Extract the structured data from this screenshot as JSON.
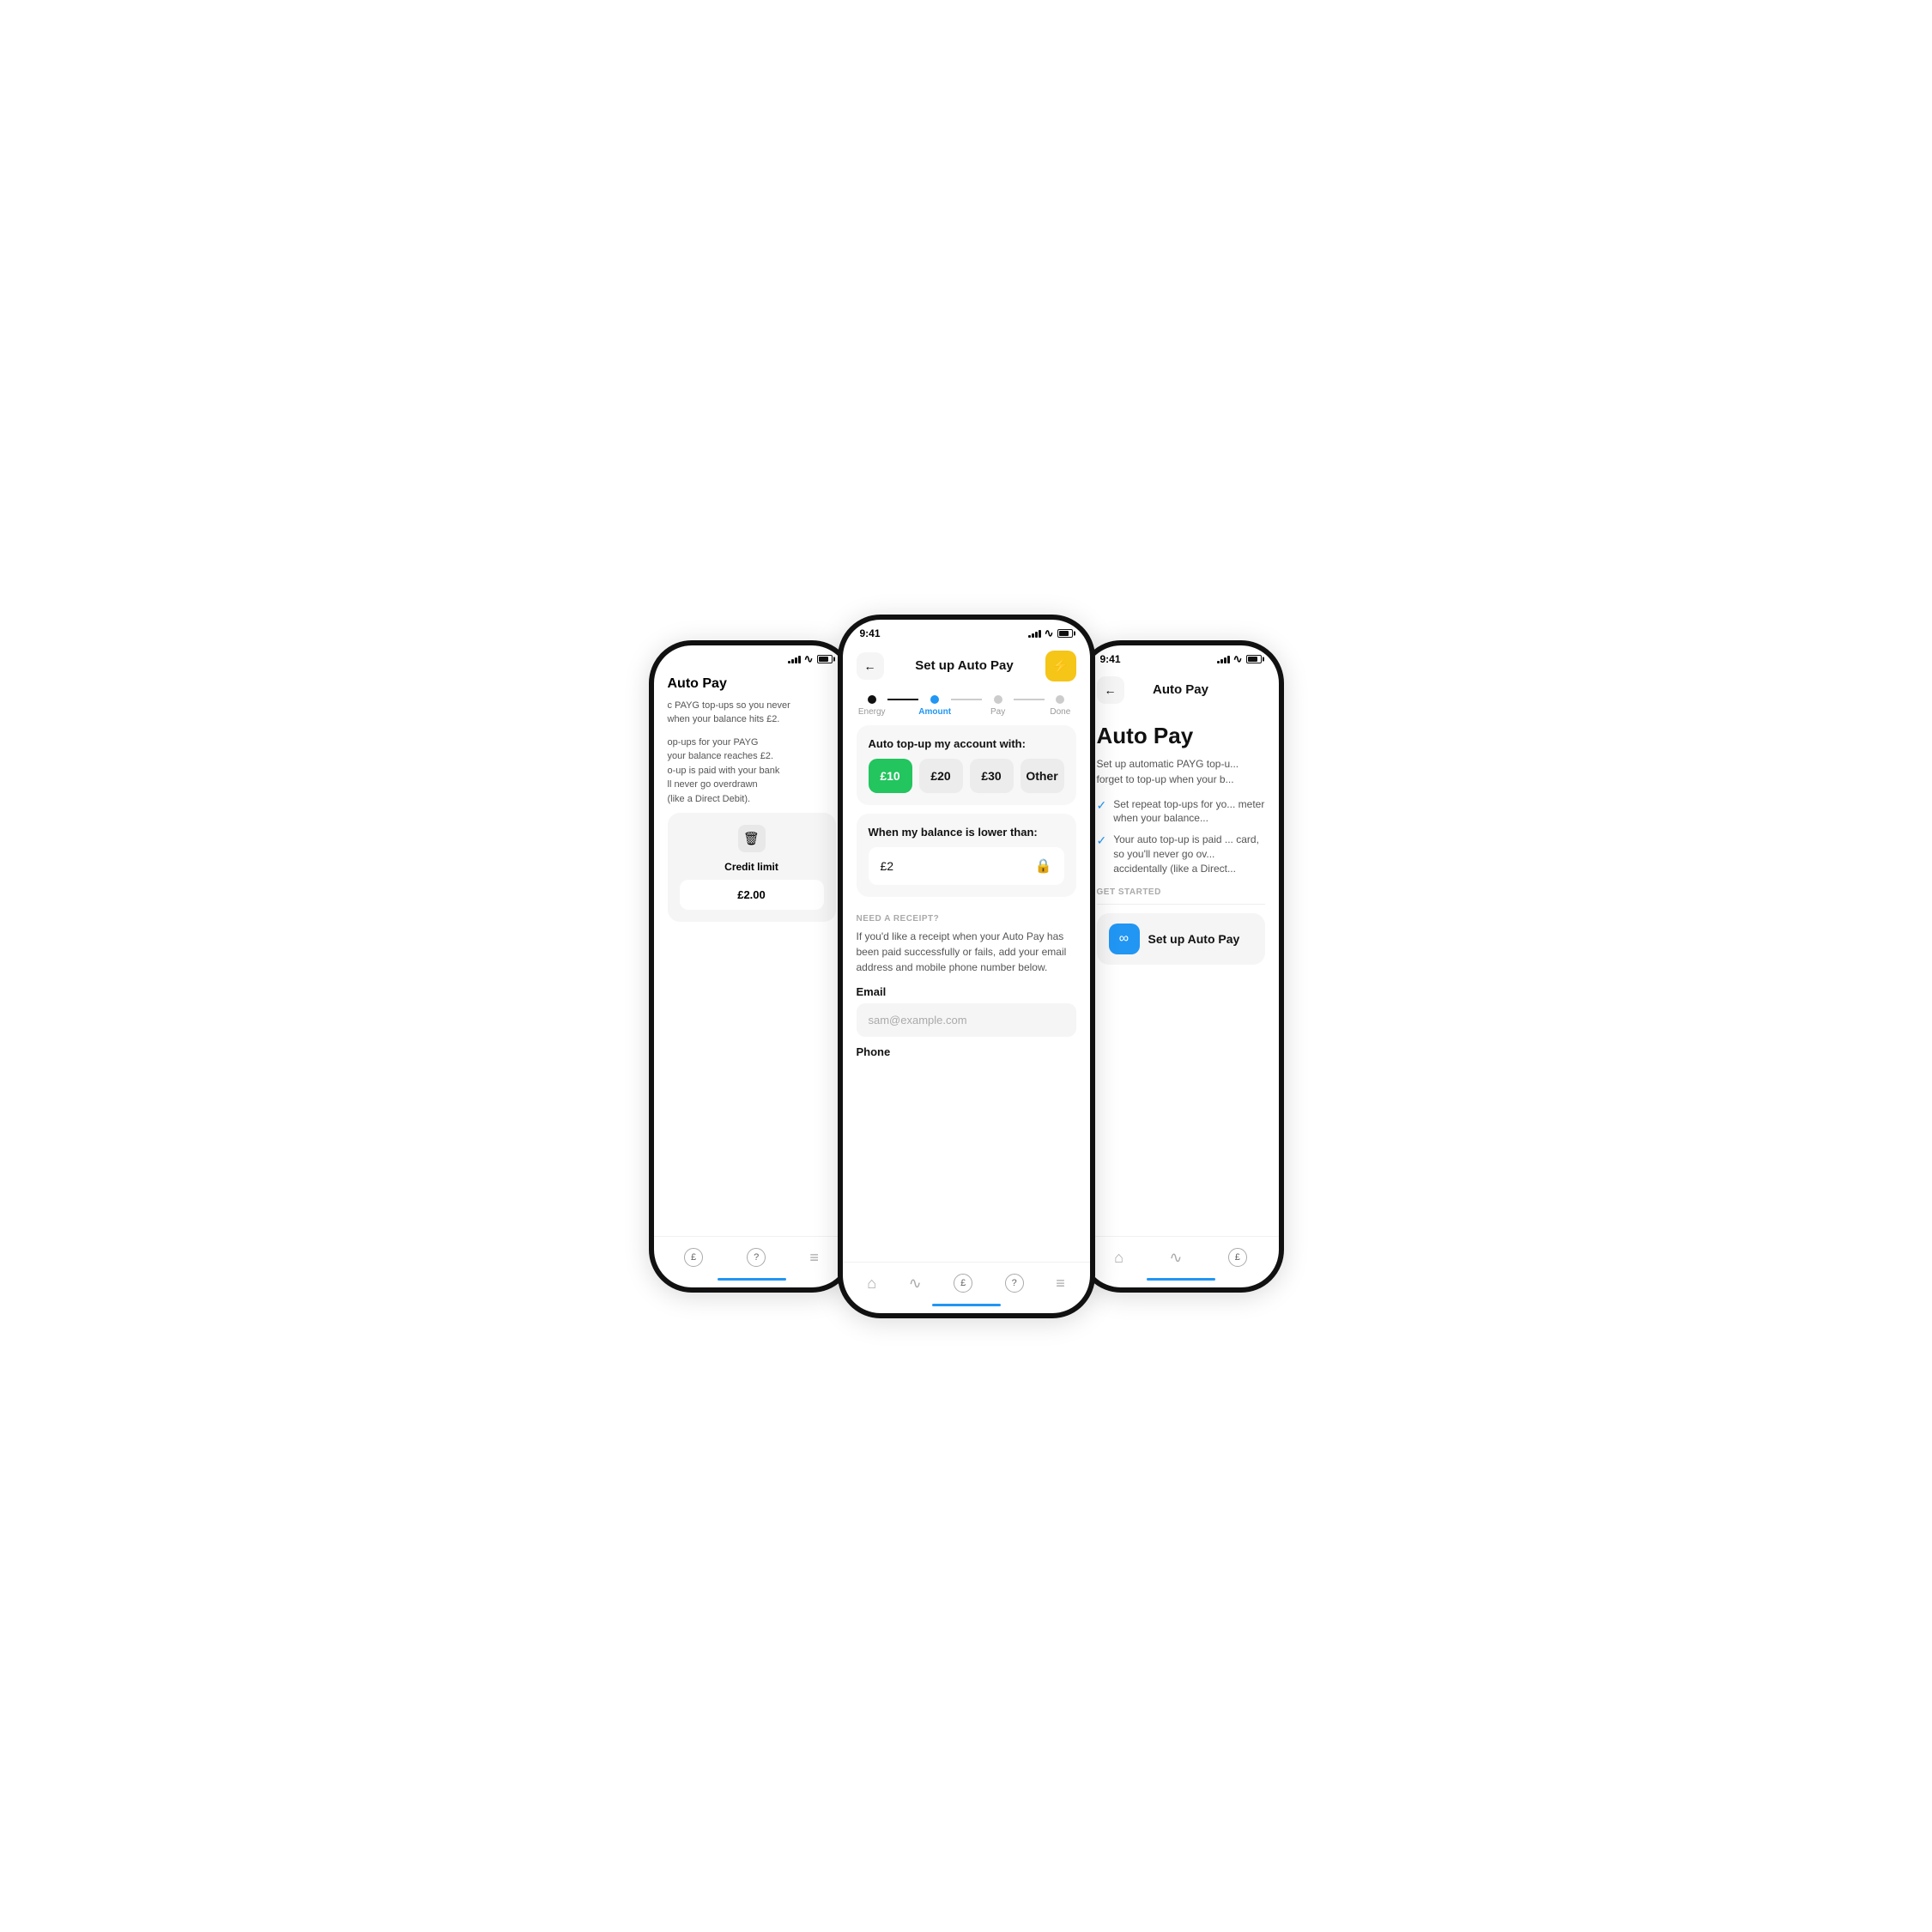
{
  "left_phone": {
    "title": "Auto Pay",
    "desc_line1": "c PAYG top-ups so you never",
    "desc_line2": "when your balance hits £2.",
    "desc_line3": "op-ups for your PAYG",
    "desc_line4": "your balance reaches £2.",
    "desc_line5": "o-up is paid with your bank",
    "desc_line6": "ll never go overdrawn",
    "desc_line7": "(like a Direct Debit).",
    "credit_label": "Credit limit",
    "credit_value": "£2.00",
    "bottom_nav": [
      "£",
      "?",
      "≡"
    ],
    "indicator_active": 0
  },
  "center_phone": {
    "status_time": "9:41",
    "nav_title": "Set up Auto Pay",
    "stepper": [
      {
        "label": "Energy",
        "state": "done"
      },
      {
        "label": "Amount",
        "state": "active"
      },
      {
        "label": "Pay",
        "state": "upcoming"
      },
      {
        "label": "Done",
        "state": "upcoming"
      }
    ],
    "section_topup_title": "Auto top-up my account with:",
    "amount_options": [
      "£10",
      "£20",
      "£30",
      "Other"
    ],
    "amount_selected": 0,
    "section_balance_title": "When my balance is lower than:",
    "balance_value": "£2",
    "receipt_label": "NEED A RECEIPT?",
    "receipt_desc": "If you'd like a receipt when your Auto Pay has been paid successfully or fails, add your email address and mobile phone number below.",
    "email_label": "Email",
    "email_placeholder": "sam@example.com",
    "phone_label": "Phone",
    "bottom_nav": [
      "⌂",
      "∿",
      "£",
      "?",
      "≡"
    ]
  },
  "right_phone": {
    "status_time": "9:41",
    "nav_title": "Auto Pay",
    "main_title": "Auto Pay",
    "main_desc": "Set up automatic PAYG top-u... forget to top-up when your b...",
    "check_items": [
      "Set repeat top-ups for yo... meter when your balance...",
      "Your auto top-up is paid ... card, so you'll never go ov... accidentally (like a Direct..."
    ],
    "get_started_label": "GET STARTED",
    "setup_btn_label": "Set up Auto Pay",
    "bottom_nav": [
      "⌂",
      "∿",
      "£"
    ]
  },
  "icons": {
    "back_arrow": "←",
    "lightning": "⚡",
    "lock": "🔒",
    "trash": "🗑",
    "infinity": "∞",
    "check": "✓"
  },
  "colors": {
    "accent_blue": "#2196F3",
    "accent_green": "#22c55e",
    "accent_yellow": "#f5c518",
    "background": "#ffffff",
    "card_bg": "#f7f7f7",
    "text_primary": "#111111",
    "text_secondary": "#555555",
    "text_muted": "#aaaaaa"
  }
}
